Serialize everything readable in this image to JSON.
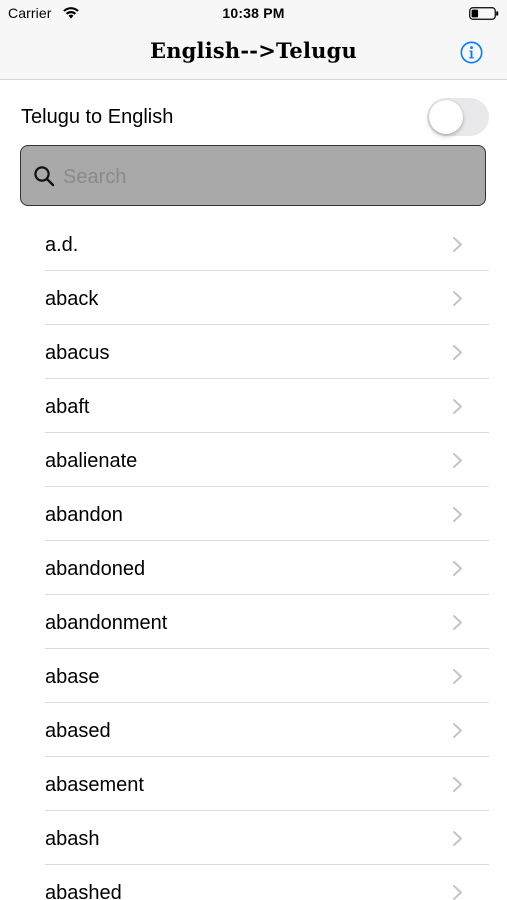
{
  "status_bar": {
    "carrier": "Carrier",
    "time": "10:38 PM"
  },
  "nav": {
    "title": "English-->Telugu",
    "info_icon": "info-circle-icon"
  },
  "toggle": {
    "label": "Telugu to English",
    "on": false
  },
  "search": {
    "placeholder": "Search",
    "value": ""
  },
  "words": [
    {
      "label": "a.d."
    },
    {
      "label": "aback"
    },
    {
      "label": "abacus"
    },
    {
      "label": "abaft"
    },
    {
      "label": "abalienate"
    },
    {
      "label": "abandon"
    },
    {
      "label": "abandoned"
    },
    {
      "label": "abandonment"
    },
    {
      "label": "abase"
    },
    {
      "label": "abased"
    },
    {
      "label": "abasement"
    },
    {
      "label": "abash"
    },
    {
      "label": "abashed"
    }
  ],
  "colors": {
    "accent": "#007aff",
    "search_bg": "#a9a9a9",
    "bar_bg": "#f7f7f7",
    "divider": "#dcdcdc",
    "chevron": "#c4c4c7"
  }
}
